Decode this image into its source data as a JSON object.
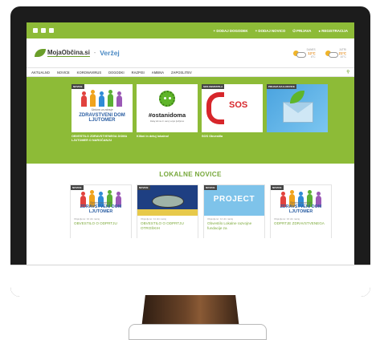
{
  "site": {
    "top_links": [
      "DODAJ DOGODEK",
      "DODAJ NOVICO",
      "PRIJAVA",
      "REGISTRACIJA"
    ],
    "logo": "MojaObčina.si",
    "town": "Veržej"
  },
  "weather": [
    {
      "day": "DANES",
      "high": "12°C",
      "low": "6°C"
    },
    {
      "day": "JUTRI",
      "high": "21°C",
      "low": "10°C"
    }
  ],
  "nav": [
    "AKTUALNO",
    "NOVICE",
    "KORONAVIRUS",
    "DOGODKI",
    "RAZPISI",
    "AMBNA",
    "ZAPOSLITEV"
  ],
  "featured": [
    {
      "badge": "NOVICE",
      "title": "OBVESTILO ZDRAVSTVENEGA DOMA LJUTOMER O NAROČANJU",
      "script": "Skrbimo za zdravje",
      "img_title": "ZDRAVSTVENI DOM LJUTOMER"
    },
    {
      "badge": "",
      "title": "Klikni in deluj lokalno!",
      "hashtag": "#ostanidoma",
      "sub": "Delaj doma in varuj svoje ljubljene"
    },
    {
      "badge": "SOS OBVESTILA",
      "title": "SOS Obvestila",
      "sos": "SOS"
    },
    {
      "badge": "PRIJAVA NA E-NOVICE",
      "title": ""
    }
  ],
  "section_title": "LOKALNE NOVICE",
  "news": [
    {
      "badge": "NOVICE",
      "date": "Objavljeno: 10 dni nazaj",
      "title": "OBVESTILO O ODPRTJU",
      "img_title": "ZDRAVSTVENI DOM LJUTOMER",
      "script": "Skrbimo za zdravje"
    },
    {
      "badge": "NOVICE",
      "date": "Objavljeno: 11 dni nazaj",
      "title": "OBVESTILO O ODPRTJU OTROŠKIH"
    },
    {
      "badge": "NOVICE",
      "date": "Objavljeno: 12 dni nazaj",
      "title": "Obvestilo Lokalne razvojne fundacije za",
      "img_title": "PROJECT"
    },
    {
      "badge": "NOVICE",
      "date": "Objavljeno: 16 dni nazaj",
      "title": "ODPRTJE ZDRAVSTVENEGA",
      "img_title": "ZDRAVSTVENI DOM LJUTOMER",
      "script": "Skrbimo za zdravje"
    }
  ],
  "colors": {
    "accent": "#8dbb37",
    "link": "#7ca93a",
    "town": "#4b8ac4",
    "sos": "#d7262b"
  }
}
